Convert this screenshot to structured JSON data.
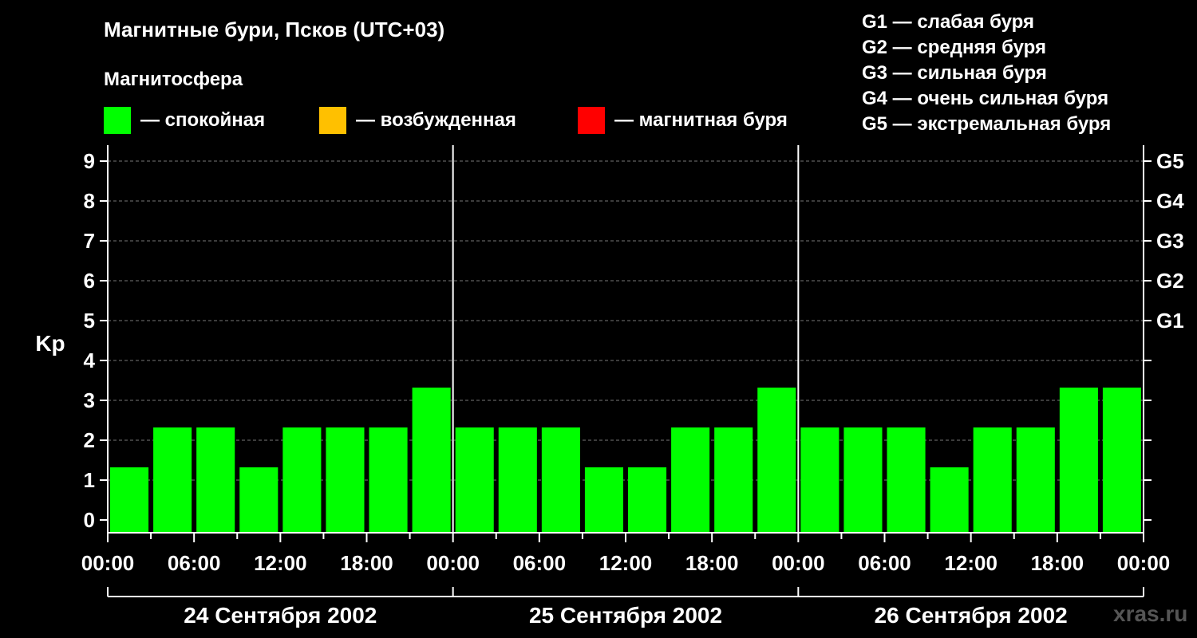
{
  "title": "Магнитные бури, Псков (UTC+03)",
  "subtitle": "Магнитосфера",
  "legend": [
    {
      "label": "— спокойная",
      "color": "#00ff00"
    },
    {
      "label": "— возбужденная",
      "color": "#ffc000"
    },
    {
      "label": "— магнитная буря",
      "color": "#ff0000"
    }
  ],
  "g_levels": [
    "G1 — слабая буря",
    "G2 — средняя буря",
    "G3 — сильная буря",
    "G4 — очень сильная буря",
    "G5 — экстремальная буря"
  ],
  "watermark": "xras.ru",
  "chart_data": {
    "type": "bar",
    "ylabel": "Kp",
    "ylim": [
      0,
      9
    ],
    "y_ticks": [
      "0",
      "1",
      "2",
      "3",
      "4",
      "5",
      "6",
      "7",
      "8",
      "9"
    ],
    "right_ticks": [
      {
        "value": 5,
        "label": "G1"
      },
      {
        "value": 6,
        "label": "G2"
      },
      {
        "value": 7,
        "label": "G3"
      },
      {
        "value": 8,
        "label": "G4"
      },
      {
        "value": 9,
        "label": "G5"
      }
    ],
    "grid": "dashed horizontal",
    "x_tick_labels": [
      "00:00",
      "06:00",
      "12:00",
      "18:00",
      "00:00",
      "06:00",
      "12:00",
      "18:00",
      "00:00",
      "06:00",
      "12:00",
      "18:00",
      "00:00"
    ],
    "days": [
      "24 Сентября 2002",
      "25 Сентября 2002",
      "26 Сентября 2002"
    ],
    "bar_color": "#00ff00",
    "series": [
      {
        "values": [
          1,
          2,
          2,
          1,
          2,
          2,
          2,
          3,
          2,
          2,
          2,
          1,
          1,
          2,
          2,
          3,
          2,
          2,
          2,
          1,
          2,
          2,
          3,
          3
        ]
      }
    ]
  }
}
